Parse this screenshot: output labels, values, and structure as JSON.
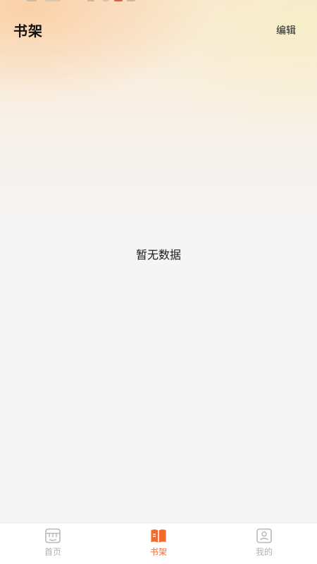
{
  "header": {
    "title": "书架",
    "edit_label": "编辑"
  },
  "main": {
    "empty_text": "暂无数据"
  },
  "tabbar": {
    "active_index": 1,
    "items": [
      {
        "label": "首页",
        "icon": "home-icon"
      },
      {
        "label": "书架",
        "icon": "book-icon"
      },
      {
        "label": "我的",
        "icon": "profile-icon"
      }
    ]
  },
  "colors": {
    "accent": "#f26b2a",
    "inactive": "#b3b3b3",
    "background": "#f5f5f5"
  }
}
